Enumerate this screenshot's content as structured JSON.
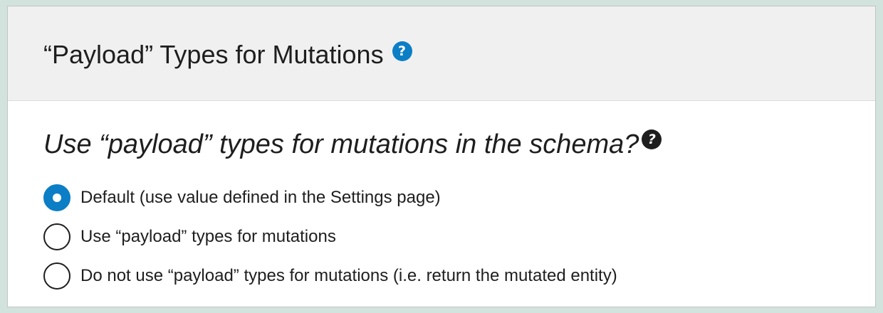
{
  "panel": {
    "title": "“Payload” Types for Mutations",
    "title_help_icon": "help-circle-icon",
    "help_glyph": "?"
  },
  "setting": {
    "question": "Use “payload” types for mutations in the schema?",
    "question_help_icon": "help-circle-icon",
    "help_glyph": "?",
    "options": [
      {
        "label": "Default (use value defined in the Settings page)",
        "checked": true
      },
      {
        "label": "Use “payload” types for mutations",
        "checked": false
      },
      {
        "label": "Do not use “payload” types for mutations (i.e. return the mutated entity)",
        "checked": false
      }
    ]
  },
  "colors": {
    "accent": "#0b7ec6",
    "page_background": "#d2e3dd",
    "header_background": "#f0f0f0"
  }
}
